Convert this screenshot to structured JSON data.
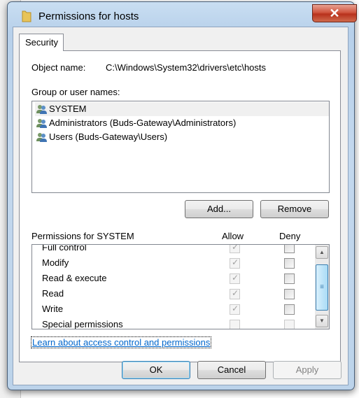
{
  "window": {
    "title": "Permissions for hosts",
    "close_label": "✕"
  },
  "tabs": [
    {
      "label": "Security"
    }
  ],
  "object": {
    "label": "Object name:",
    "value": "C:\\Windows\\System32\\drivers\\etc\\hosts"
  },
  "groups": {
    "label": "Group or user names:",
    "items": [
      {
        "name": "SYSTEM",
        "selected": true
      },
      {
        "name": "Administrators (Buds-Gateway\\Administrators)",
        "selected": false
      },
      {
        "name": "Users (Buds-Gateway\\Users)",
        "selected": false
      }
    ],
    "icon": "users-icon"
  },
  "buttons": {
    "add": "Add...",
    "remove": "Remove",
    "ok": "OK",
    "cancel": "Cancel",
    "apply": "Apply"
  },
  "permissions": {
    "label": "Permissions for SYSTEM",
    "allow_header": "Allow",
    "deny_header": "Deny",
    "rows": [
      {
        "name": "Full control",
        "allow": true,
        "deny": false
      },
      {
        "name": "Modify",
        "allow": true,
        "deny": false
      },
      {
        "name": "Read & execute",
        "allow": true,
        "deny": false
      },
      {
        "name": "Read",
        "allow": true,
        "deny": false
      },
      {
        "name": "Write",
        "allow": true,
        "deny": false
      },
      {
        "name": "Special permissions",
        "allow": false,
        "deny": false
      }
    ]
  },
  "link": "Learn about access control and permissions",
  "colors": {
    "link": "#0066cc",
    "close": "#c7452d",
    "selection": "#f0f0f0"
  }
}
